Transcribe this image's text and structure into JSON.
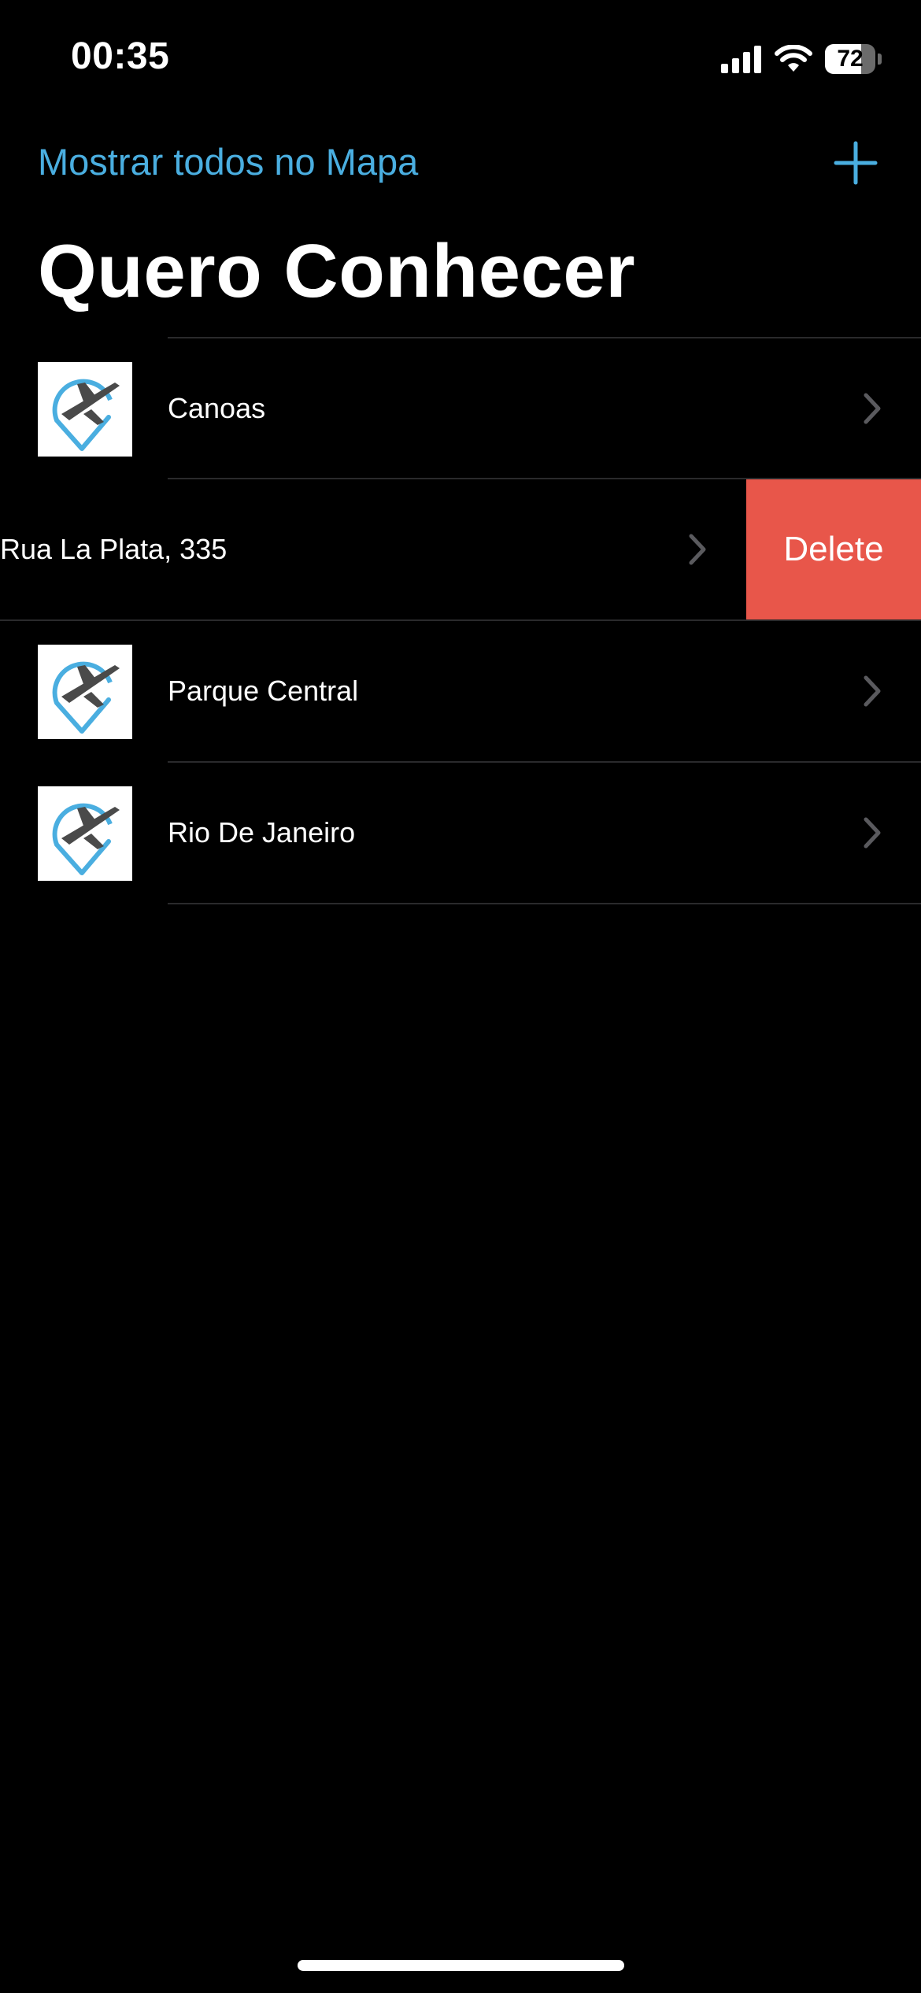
{
  "status_bar": {
    "time": "00:35",
    "battery_level": "72",
    "battery_fraction": 0.72,
    "icons": [
      "cellular-signal-icon",
      "wifi-icon",
      "battery-icon"
    ]
  },
  "nav": {
    "show_all_on_map": "Mostrar todos no Mapa",
    "add_icon": "plus-icon"
  },
  "title": "Quero Conhecer",
  "colors": {
    "accent": "#4aaee0",
    "delete": "#e8564a",
    "background": "#000000",
    "separator": "#2a2a2c",
    "chevron": "#5a5a5e"
  },
  "places": [
    {
      "name": "Canoas",
      "icon": "travel-pin-plane-icon",
      "swiped": false
    },
    {
      "name": "Rua La Plata, 335",
      "icon": "travel-pin-plane-icon",
      "swiped": true,
      "action": "Delete"
    },
    {
      "name": "Parque Central",
      "icon": "travel-pin-plane-icon",
      "swiped": false
    },
    {
      "name": "Rio De Janeiro",
      "icon": "travel-pin-plane-icon",
      "swiped": false
    }
  ]
}
